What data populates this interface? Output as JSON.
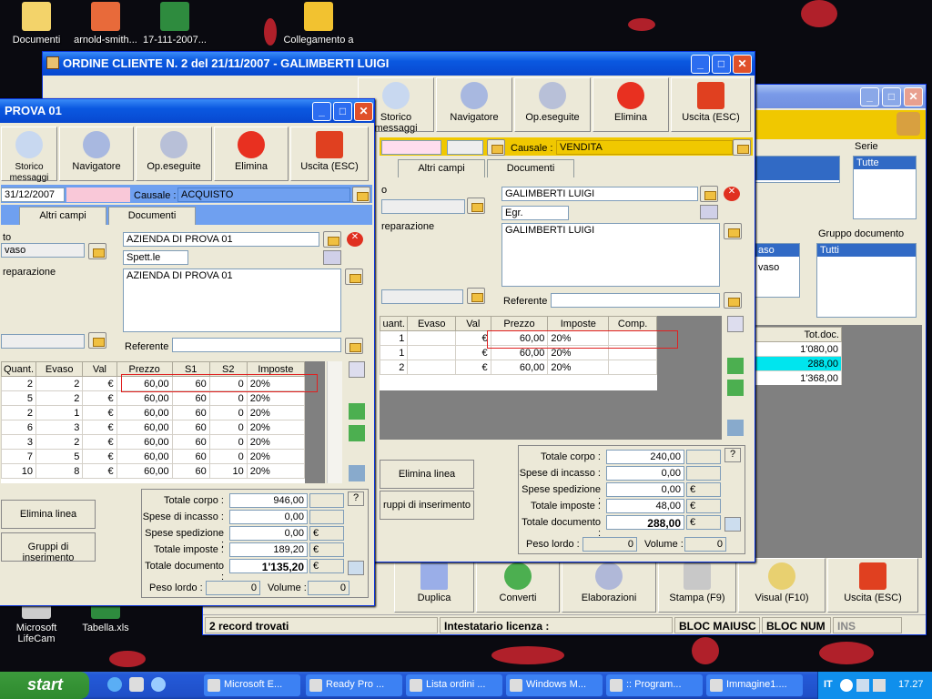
{
  "desktop": {
    "icons": [
      {
        "label": "Documenti",
        "icon": "folder-icon"
      },
      {
        "label": "arnold-smith...",
        "icon": "image-file-icon"
      },
      {
        "label": "17-111-2007...",
        "icon": "excel-file-icon"
      },
      {
        "label": "Collegamento a",
        "icon": "shortcut-icon"
      },
      {
        "label": "Microsoft LifeCam",
        "icon": "webcam-icon"
      },
      {
        "label": "Tabella.xls",
        "icon": "excel-file-icon"
      }
    ]
  },
  "list_window": {
    "filters": {
      "serie_label": "Serie",
      "serie_selected": "Tutte",
      "gruppo_label": "Gruppo documento",
      "gruppo_selected": "Tutti",
      "left_items": [
        "aso",
        "vaso"
      ]
    },
    "grid": {
      "header": "Tot.doc.",
      "rows": [
        "1'080,00",
        "288,00",
        "1'368,00"
      ]
    },
    "bottom_toolbar": [
      "Duplica",
      "Converti",
      "Elaborazioni",
      "Stampa (F9)",
      "Visual (F10)",
      "Uscita (ESC)"
    ],
    "status": {
      "records": "2 record trovati",
      "license": "Intestatario licenza :",
      "caps": "BLOC MAIUSC",
      "num": "BLOC NUM",
      "ins": "INS"
    }
  },
  "order_window": {
    "title": "ORDINE CLIENTE N. 2  del 21/11/2007 - GALIMBERTI LUIGI",
    "toolbar": [
      "Storico messaggi",
      "Navigatore",
      "Op.eseguite",
      "Elimina",
      "Uscita (ESC)"
    ],
    "causale_label": "Causale :",
    "causale_value": "VENDITA",
    "tabs": [
      "Altri campi",
      "Documenti"
    ],
    "left_labels": [
      "o",
      "reparazione"
    ],
    "customer_name": "GALIMBERTI LUIGI",
    "title_field": "Egr.",
    "address": "GALIMBERTI LUIGI",
    "referente_label": "Referente",
    "grid": {
      "headers": [
        "uant.",
        "Evaso",
        "Val",
        "Prezzo",
        "Imposte",
        "Comp."
      ],
      "rows": [
        [
          "1",
          "",
          "€",
          "60,00",
          "20%",
          ""
        ],
        [
          "1",
          "",
          "€",
          "60,00",
          "20%",
          ""
        ],
        [
          "2",
          "",
          "€",
          "60,00",
          "20%",
          ""
        ]
      ]
    },
    "buttons": [
      "Elimina linea",
      "ruppi di inserimento"
    ],
    "totals": [
      {
        "label": "Totale corpo :",
        "value": "240,00",
        "unit": ""
      },
      {
        "label": "Spese di incasso :",
        "value": "0,00",
        "unit": ""
      },
      {
        "label": "Spese spedizione :",
        "value": "0,00",
        "unit": "€"
      },
      {
        "label": "Totale imposte :",
        "value": "48,00",
        "unit": "€"
      },
      {
        "label": "Totale documento :",
        "value": "288,00",
        "unit": "€"
      }
    ],
    "peso_label": "Peso lordo :",
    "peso_value": "0",
    "volume_label": "Volume :",
    "volume_value": "0",
    "help": "?"
  },
  "prova_window": {
    "title": "PROVA 01",
    "toolbar": [
      "Storico messaggi",
      "Navigatore",
      "Op.eseguite",
      "Elimina",
      "Uscita (ESC)"
    ],
    "date": "31/12/2007",
    "causale_label": "Causale :",
    "causale_value": "ACQUISTO",
    "tabs": [
      "Altri campi",
      "Documenti"
    ],
    "left_labels": [
      "to",
      "vaso",
      "reparazione"
    ],
    "customer_name": "AZIENDA DI PROVA 01",
    "title_field": "Spett.le",
    "address": "AZIENDA DI PROVA 01",
    "referente_label": "Referente",
    "grid": {
      "headers": [
        "Quant.",
        "Evaso",
        "Val",
        "Prezzo",
        "S1",
        "S2",
        "Imposte"
      ],
      "rows": [
        [
          "2",
          "2",
          "€",
          "60,00",
          "60",
          "0",
          "20%"
        ],
        [
          "5",
          "2",
          "€",
          "60,00",
          "60",
          "0",
          "20%"
        ],
        [
          "2",
          "1",
          "€",
          "60,00",
          "60",
          "0",
          "20%"
        ],
        [
          "6",
          "3",
          "€",
          "60,00",
          "60",
          "0",
          "20%"
        ],
        [
          "3",
          "2",
          "€",
          "60,00",
          "60",
          "0",
          "20%"
        ],
        [
          "7",
          "5",
          "€",
          "60,00",
          "60",
          "0",
          "20%"
        ],
        [
          "10",
          "8",
          "€",
          "60,00",
          "60",
          "10",
          "20%"
        ]
      ]
    },
    "buttons": [
      "Elimina linea",
      "Gruppi di inserimento"
    ],
    "totals": [
      {
        "label": "Totale corpo :",
        "value": "946,00",
        "unit": ""
      },
      {
        "label": "Spese di incasso :",
        "value": "0,00",
        "unit": ""
      },
      {
        "label": "Spese spedizione :",
        "value": "0,00",
        "unit": "€"
      },
      {
        "label": "Totale imposte :",
        "value": "189,20",
        "unit": "€"
      },
      {
        "label": "Totale documento :",
        "value": "1'135,20",
        "unit": "€"
      }
    ],
    "peso_label": "Peso lordo :",
    "peso_value": "0",
    "volume_label": "Volume :",
    "volume_value": "0",
    "help": "?"
  },
  "taskbar": {
    "start": "start",
    "tasks": [
      "Microsoft E...",
      "Ready Pro ...",
      "Lista ordini ...",
      "Windows M...",
      ":: Program...",
      "Immagine1...."
    ],
    "lang": "IT",
    "clock": "17.27"
  },
  "colors": {
    "title_active": "#0a58e0",
    "accent_yellow": "#f0c800",
    "grid_dark": "#808080",
    "selection": "#316ac5"
  }
}
